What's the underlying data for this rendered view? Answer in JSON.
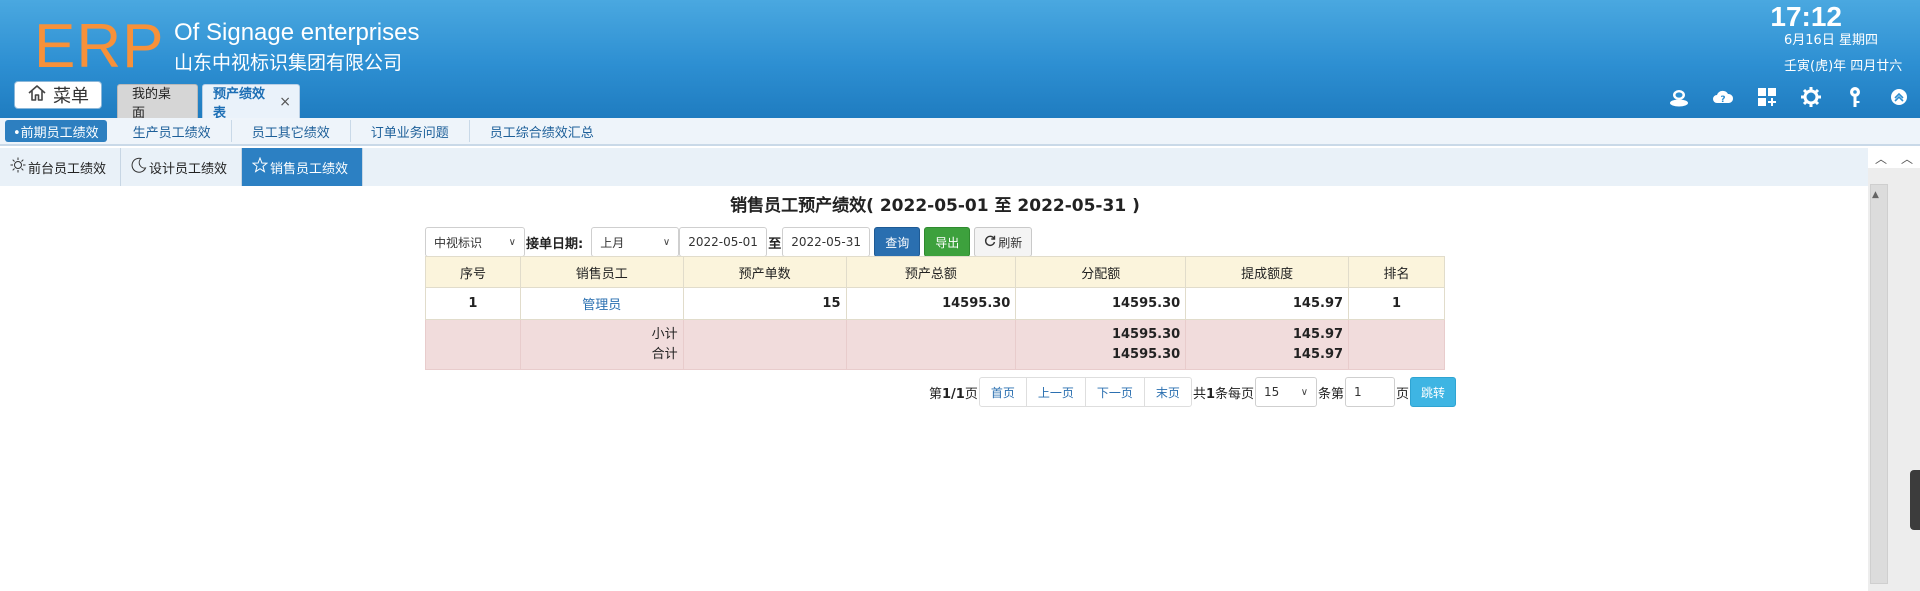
{
  "header": {
    "logo": "ERP",
    "company_en": "Of Signage enterprises",
    "company_cn": "山东中视标识集团有限公司",
    "time": "17:12",
    "date": "6月16日 星期四",
    "lunar": "壬寅(虎)年 四月廿六",
    "menu_label": "菜单",
    "tabs": [
      {
        "label": "我的桌面"
      },
      {
        "label": "预产绩效表",
        "close": "×"
      }
    ],
    "icons": [
      "user-icon",
      "help-cloud-icon",
      "apps-icon",
      "settings-gear-icon",
      "key-icon",
      "collapse-up-icon"
    ]
  },
  "subnav": {
    "items": [
      {
        "label": "•前期员工绩效",
        "active": true
      },
      {
        "label": "生产员工绩效"
      },
      {
        "label": "员工其它绩效"
      },
      {
        "label": "订单业务问题"
      },
      {
        "label": "员工综合绩效汇总"
      }
    ]
  },
  "inner_tabs": {
    "items": [
      {
        "label": "前台员工绩效",
        "icon": "sun-icon"
      },
      {
        "label": "设计员工绩效",
        "icon": "moon-icon"
      },
      {
        "label": "销售员工绩效",
        "icon": "star-icon",
        "active": true
      }
    ]
  },
  "report": {
    "title": "销售员工预产绩效( 2022-05-01 至 2022-05-31 )",
    "filters": {
      "company": "中视标识",
      "date_label": "接单日期:",
      "period": "上月",
      "start": "2022-05-01",
      "sep": "至",
      "end": "2022-05-31",
      "query": "查询",
      "export": "导出",
      "refresh": "刷新"
    },
    "columns": [
      "序号",
      "销售员工",
      "预产单数",
      "预产总额",
      "分配额",
      "提成额度",
      "排名"
    ],
    "rows": [
      {
        "no": "1",
        "employee": "管理员",
        "orders": "15",
        "total": "14595.30",
        "allocated": "14595.30",
        "commission": "145.97",
        "rank": "1"
      }
    ],
    "subtotal": {
      "label": "小计",
      "allocated": "14595.30",
      "commission": "145.97"
    },
    "grand_total": {
      "label": "合计",
      "allocated": "14595.30",
      "commission": "145.97"
    }
  },
  "pager": {
    "page_prefix": "第",
    "page_value": "1/1",
    "page_suffix": "页",
    "first": "首页",
    "prev": "上一页",
    "next": "下一页",
    "last": "末页",
    "total_prefix": "共",
    "total_value": "1",
    "total_suffix": "条每页",
    "page_size": "15",
    "goto_prefix": "条第",
    "goto_value": "1",
    "goto_suffix": "页",
    "go": "跳转"
  }
}
